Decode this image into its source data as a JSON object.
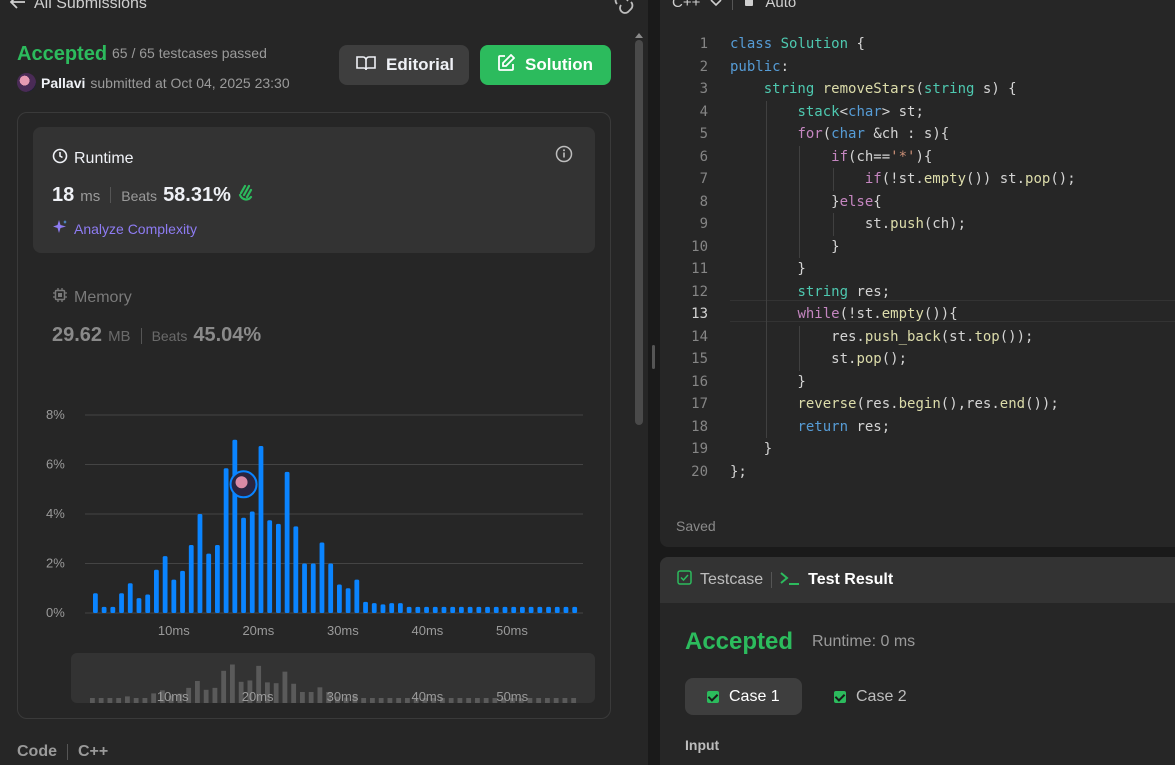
{
  "left": {
    "back_label": "All Submissions",
    "status": "Accepted",
    "testcases": "65 / 65 testcases passed",
    "submitter_name": "Pallavi",
    "submitted_at": "submitted at Oct 04, 2025 23:30",
    "editorial_label": "Editorial",
    "solution_label": "Solution",
    "runtime": {
      "title": "Runtime",
      "value": "18",
      "unit": "ms",
      "beats_label": "Beats",
      "beats_value": "58.31%",
      "analyze_label": "Analyze Complexity"
    },
    "memory": {
      "title": "Memory",
      "value": "29.62",
      "unit": "MB",
      "beats_label": "Beats",
      "beats_value": "45.04%"
    },
    "code_label": "Code",
    "code_lang": "C++"
  },
  "chart_data": {
    "type": "bar",
    "title": "",
    "xlabel": "",
    "ylabel": "",
    "x_ticks": [
      "10ms",
      "20ms",
      "30ms",
      "40ms",
      "50ms"
    ],
    "y_ticks": [
      "0%",
      "2%",
      "4%",
      "6%",
      "8%"
    ],
    "ylim": [
      0,
      8
    ],
    "values": [
      0.8,
      0.25,
      0.25,
      0.8,
      1.2,
      0.6,
      0.75,
      1.75,
      2.3,
      1.35,
      1.7,
      2.75,
      4.0,
      2.4,
      2.75,
      5.85,
      7.0,
      3.85,
      4.1,
      6.75,
      3.75,
      3.6,
      5.7,
      3.5,
      2.0,
      2.0,
      2.85,
      2.0,
      1.15,
      1.0,
      1.35,
      0.45,
      0.4,
      0.35,
      0.4,
      0.4,
      0.25,
      0.25,
      0.25,
      0.25,
      0.25,
      0.25,
      0.25,
      0.25,
      0.25,
      0.25,
      0.25,
      0.25,
      0.25,
      0.25,
      0.25,
      0.25,
      0.25,
      0.25,
      0.25,
      0.25
    ],
    "highlight_index": 17,
    "bar_color": "#0a84ff",
    "grid": true
  },
  "editor": {
    "language": "C++",
    "mode": "Auto",
    "saved": "Saved",
    "current_line": 13,
    "lines": [
      "class Solution {",
      "public:",
      "    string removeStars(string s) {",
      "        stack<char> st;",
      "        for(char &ch : s){",
      "            if(ch=='*'){",
      "                if(!st.empty()) st.pop();",
      "            }else{",
      "                st.push(ch);",
      "            }",
      "        }",
      "        string res;",
      "        while(!st.empty()){",
      "            res.push_back(st.top());",
      "            st.pop();",
      "        }",
      "        reverse(res.begin(),res.end());",
      "        return res;",
      "    }",
      "};"
    ]
  },
  "test_result": {
    "tab_testcase": "Testcase",
    "tab_result": "Test Result",
    "status": "Accepted",
    "runtime": "Runtime: 0 ms",
    "case1": "Case 1",
    "case2": "Case 2",
    "input_label": "Input"
  },
  "colors": {
    "accent_green": "#2cbb5d",
    "bar_blue": "#0a84ff",
    "analyze_purple": "#8e7cf3"
  }
}
